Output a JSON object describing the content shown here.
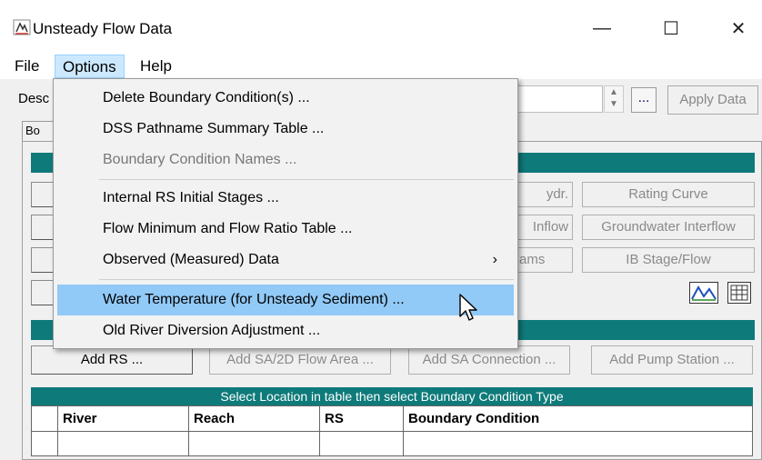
{
  "window": {
    "title": "Unsteady Flow Data",
    "minimize": "—",
    "maximize": "☐",
    "close": "✕"
  },
  "menubar": {
    "file": "File",
    "options": "Options",
    "help": "Help"
  },
  "description": {
    "label": "Desc",
    "value": "",
    "ellipsis": "...",
    "apply_label": "Apply Data"
  },
  "tab": {
    "label": "Bo"
  },
  "buttons": {
    "row1": {
      "partial": "ydr.",
      "rating_curve": "Rating Curve"
    },
    "row2": {
      "partial": "Inflow",
      "groundwater": "Groundwater Interflow"
    },
    "row3": {
      "partial": "ams",
      "ib_stage": "IB Stage/Flow"
    },
    "add_rs": "Add RS ...",
    "add_sa_2d": "Add SA/2D Flow Area ...",
    "add_sa_conn": "Add SA Connection ...",
    "add_pump": "Add Pump Station ..."
  },
  "options_menu": {
    "items": [
      {
        "label": "Delete Boundary Condition(s) ...",
        "enabled": true
      },
      {
        "label": "DSS Pathname Summary Table ...",
        "enabled": true
      },
      {
        "label": "Boundary Condition Names ...",
        "enabled": false
      },
      {
        "label": "Internal RS Initial Stages ...",
        "enabled": true
      },
      {
        "label": "Flow Minimum and Flow Ratio Table ...",
        "enabled": true
      },
      {
        "label": "Observed (Measured) Data",
        "enabled": true,
        "submenu_arrow": "›"
      },
      {
        "label": "Water Temperature (for Unsteady Sediment) ...",
        "enabled": true,
        "highlighted": true
      },
      {
        "label": "Old River Diversion Adjustment ...",
        "enabled": true
      }
    ]
  },
  "table": {
    "instruction": "Select Location in table then select Boundary Condition Type",
    "columns": [
      "River",
      "Reach",
      "RS",
      "Boundary Condition"
    ]
  },
  "colors": {
    "teal": "#0f7a7a",
    "menu_highlight": "#91c9f7",
    "active_menu": "#cce8ff"
  }
}
